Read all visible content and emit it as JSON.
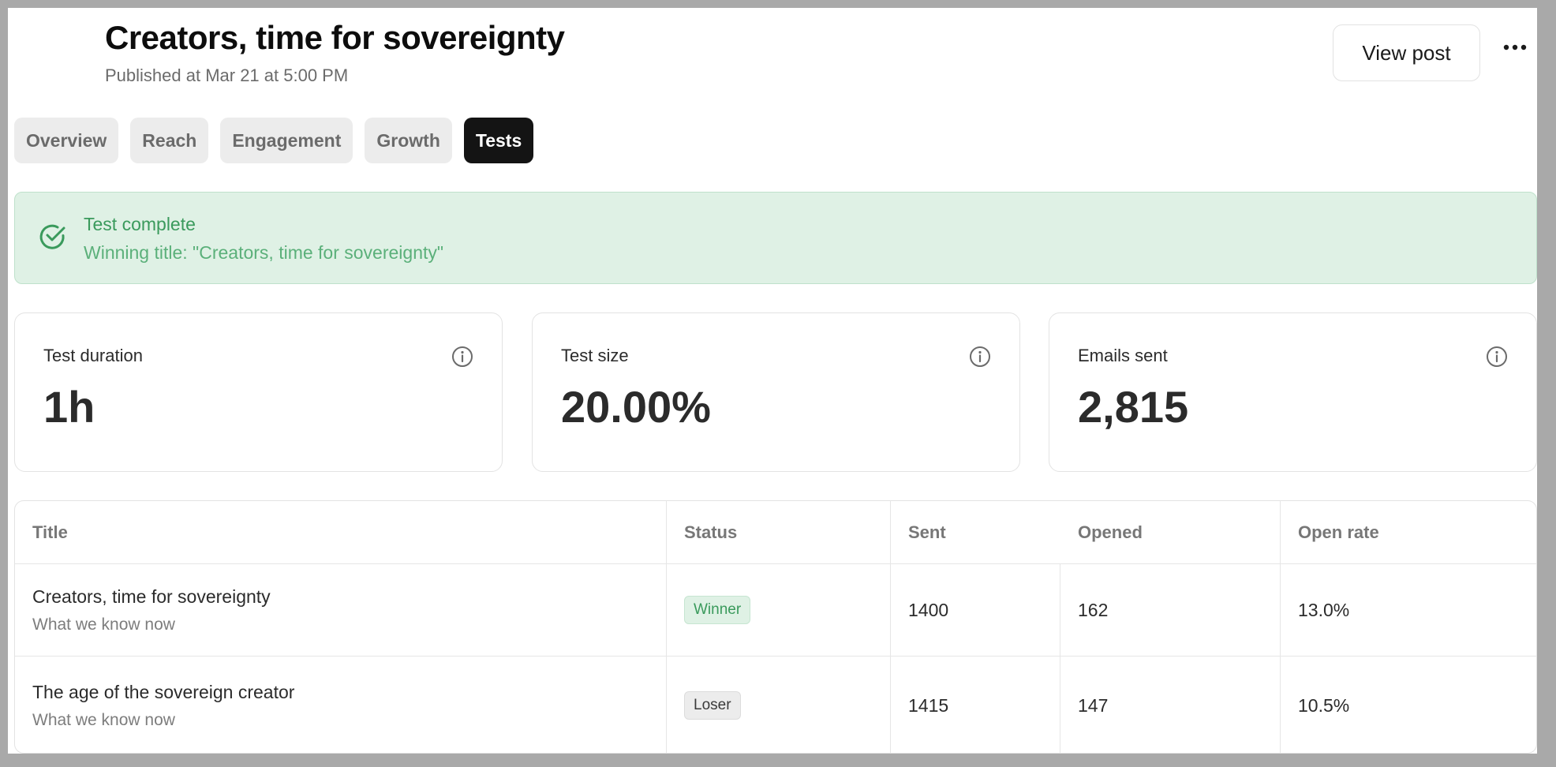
{
  "header": {
    "title": "Creators, time for sovereignty",
    "published": "Published at Mar 21 at 5:00 PM",
    "view_post_label": "View post"
  },
  "tabs": [
    {
      "label": "Overview",
      "active": false
    },
    {
      "label": "Reach",
      "active": false
    },
    {
      "label": "Engagement",
      "active": false
    },
    {
      "label": "Growth",
      "active": false
    },
    {
      "label": "Tests",
      "active": true
    }
  ],
  "banner": {
    "title": "Test complete",
    "subtitle": "Winning title: \"Creators, time for sovereignty\"",
    "icon": "check-circle-icon",
    "color": "#3a9a5c"
  },
  "stats": [
    {
      "label": "Test duration",
      "value": "1h"
    },
    {
      "label": "Test size",
      "value": "20.00%"
    },
    {
      "label": "Emails sent",
      "value": "2,815"
    }
  ],
  "table": {
    "columns": [
      "Title",
      "Status",
      "Sent",
      "Opened",
      "Open rate"
    ],
    "rows": [
      {
        "title": "Creators, time for sovereignty",
        "subtitle": "What we know now",
        "status": "Winner",
        "sent": "1400",
        "opened": "162",
        "open_rate": "13.0%"
      },
      {
        "title": "The age of the sovereign creator",
        "subtitle": "What we know now",
        "status": "Loser",
        "sent": "1415",
        "opened": "147",
        "open_rate": "10.5%"
      }
    ]
  }
}
